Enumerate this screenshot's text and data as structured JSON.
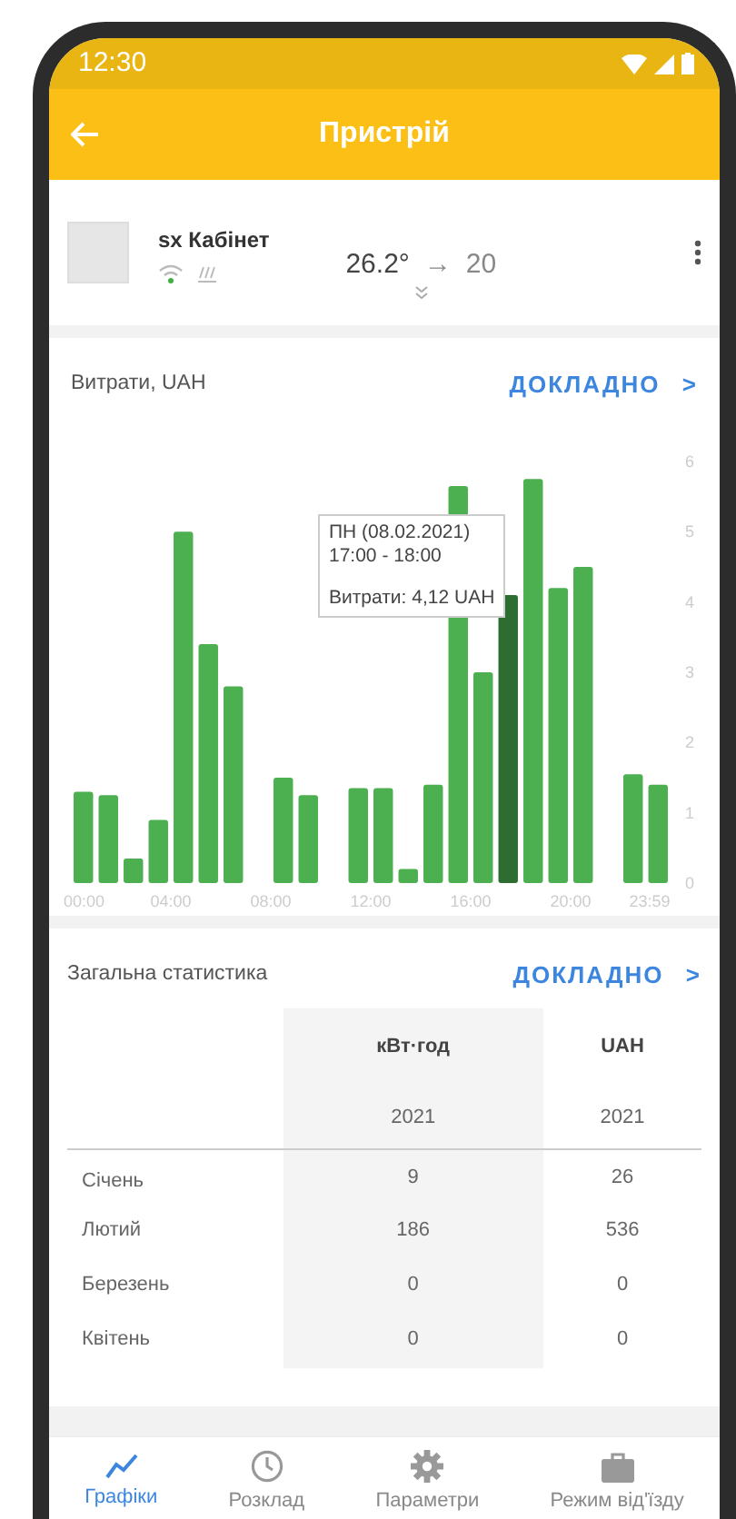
{
  "status_bar": {
    "time": "12:30"
  },
  "app_bar": {
    "title": "Пристрій"
  },
  "device": {
    "name": "sx Кабінет",
    "current_temp": "26.2°",
    "arrow": "→",
    "target_temp": "20"
  },
  "expenses": {
    "title": "Витрати, UAH",
    "link": "ДОКЛАДНО",
    "link_arrow": ">",
    "chart_data": {
      "type": "bar",
      "x": [
        0.5,
        1.5,
        2.5,
        3.5,
        4.5,
        5.5,
        6.5,
        7.5,
        8.5,
        9.5,
        10.5,
        11.5,
        12.5,
        13.5,
        14.5,
        15.5,
        16.5,
        17.5,
        18.5,
        19.5,
        20.5,
        21.5,
        22.5,
        23.5
      ],
      "series": [
        {
          "color": "#4caf50",
          "values": [
            1.3,
            1.25,
            0.35,
            0.9,
            5.0,
            3.4,
            2.8,
            null,
            1.5,
            1.25,
            null,
            1.35,
            1.35,
            0.2,
            1.4,
            5.65,
            3.0,
            null,
            5.75,
            4.2,
            4.5,
            null,
            1.55,
            1.4
          ]
        },
        {
          "color": "#2e6d31",
          "values": [
            null,
            null,
            null,
            null,
            null,
            null,
            null,
            null,
            null,
            null,
            null,
            null,
            null,
            null,
            null,
            null,
            null,
            4.1,
            null,
            null,
            null,
            null,
            null,
            null
          ]
        }
      ],
      "stacked": true,
      "xlim": [
        0,
        24
      ],
      "ylim": [
        0,
        6
      ],
      "xticks": [
        {
          "value": 0,
          "label": "00:00"
        },
        {
          "value": 4,
          "label": "04:00"
        },
        {
          "value": 8,
          "label": "08:00"
        },
        {
          "value": 12,
          "label": "12:00"
        },
        {
          "value": 16,
          "label": "16:00"
        },
        {
          "value": 20,
          "label": "20:00"
        },
        {
          "value": 23.983,
          "label": "23:59"
        }
      ],
      "yticks": [
        0,
        1,
        2,
        3,
        4,
        5,
        6
      ]
    },
    "tooltip": {
      "lines": [
        "ПН (08.02.2021)",
        "17:00 - 18:00",
        "Витрати: 4,12 UAH"
      ]
    }
  },
  "stats": {
    "title": "Загальна статистика",
    "link": "ДОКЛАДНО",
    "link_arrow": ">",
    "columns": [
      {
        "unit": "кВт·год",
        "year": "2021"
      },
      {
        "unit": "UAH",
        "year": "2021"
      }
    ],
    "rows": [
      {
        "month": "Січень",
        "values": [
          "9",
          "26"
        ]
      },
      {
        "month": "Лютий",
        "values": [
          "186",
          "536"
        ]
      },
      {
        "month": "Березень",
        "values": [
          "0",
          "0"
        ]
      },
      {
        "month": "Квітень",
        "values": [
          "0",
          "0"
        ]
      }
    ]
  },
  "bottom_nav": [
    {
      "kind": "charts",
      "label": "Графіки",
      "selected": true
    },
    {
      "kind": "schedule",
      "label": "Розклад",
      "selected": false
    },
    {
      "kind": "settings",
      "label": "Параметри",
      "selected": false
    },
    {
      "kind": "away",
      "label": "Режим від'їзду",
      "selected": false
    }
  ]
}
